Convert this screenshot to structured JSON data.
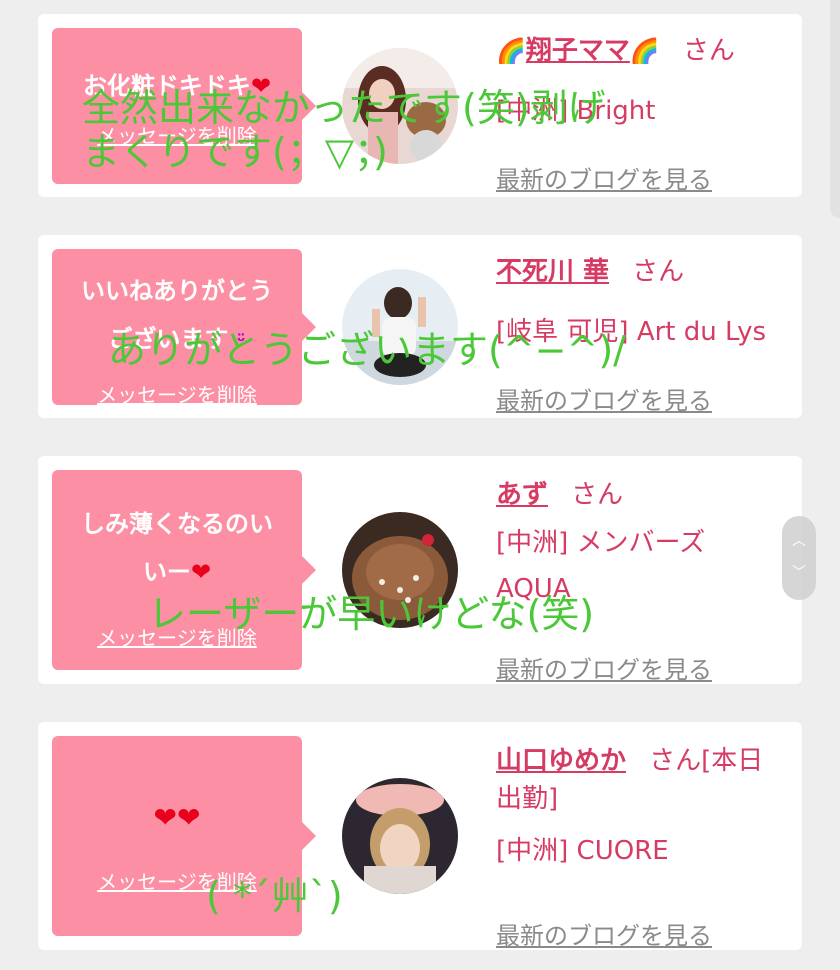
{
  "cards": [
    {
      "message_lines": [
        "お化粧ドキドキ"
      ],
      "message_suffix": "❤",
      "delete_label": "メッセージを削除",
      "name": "翔子ママ",
      "name_prefix_icon": "🌈",
      "name_suffix_icon": "🌈",
      "honorific": "さん",
      "shop": "[中洲] Bright",
      "blog_link": "最新のブログを見る",
      "overlay": [
        "全然出来なかったです(笑)剥げ",
        "まくりです(；▽；)"
      ]
    },
    {
      "message_lines": [
        "いいねありがとう",
        "ございます"
      ],
      "message_suffix": "ᵕ̈",
      "delete_label": "メッセージを削除",
      "name": "不死川 華",
      "honorific": "さん",
      "shop": "[岐阜 可児] Art du Lys",
      "blog_link": "最新のブログを見る",
      "overlay": [
        "ありがとうございます(^−^)/"
      ]
    },
    {
      "message_lines": [
        "しみ薄くなるのい",
        "いー"
      ],
      "message_suffix": "❤",
      "delete_label": "メッセージを削除",
      "name": "あず",
      "honorific": "さん",
      "shop_lines": [
        "[中洲] メンバーズ",
        "AQUA"
      ],
      "blog_link": "最新のブログを見る",
      "overlay": [
        "レーザーが早いけどな(笑)"
      ]
    },
    {
      "message_hearts": "❤❤",
      "delete_label": "メッセージを削除",
      "name": "山口ゆめか",
      "honorific": "さん[本日",
      "honorific_line2": "出勤]",
      "shop": "[中洲] CUORE",
      "blog_link": "最新のブログを見る",
      "overlay": [
        "( *´艸`)"
      ]
    }
  ],
  "colors": {
    "bubble": "#fc8fa3",
    "name": "#d63c63",
    "overlay_text": "#4bc837",
    "heart": "#e8001c"
  },
  "scroll_icons": [
    "chevron-up-icon",
    "chevron-down-icon"
  ]
}
